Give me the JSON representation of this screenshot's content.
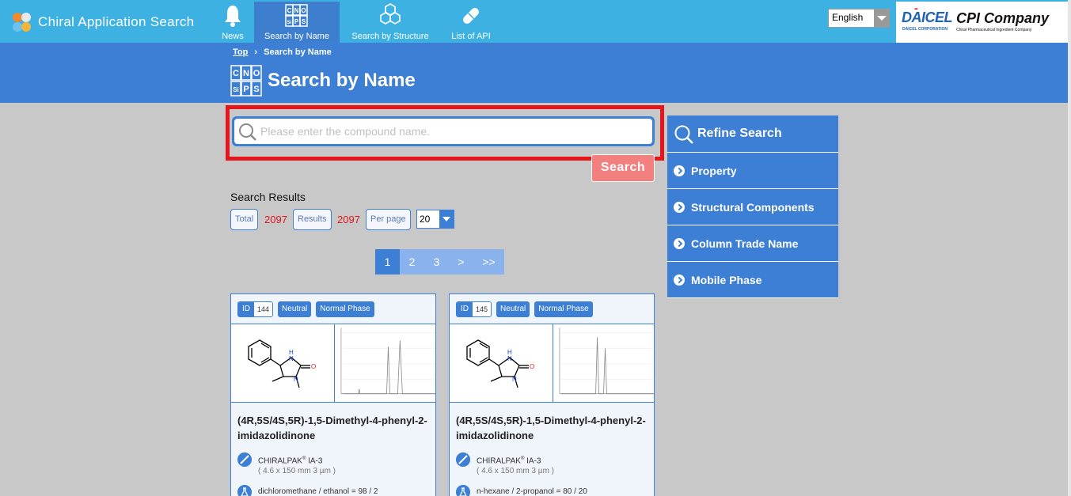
{
  "app": {
    "title": "Chiral Application Search"
  },
  "nav": [
    {
      "label": "News",
      "icon": "bell-icon"
    },
    {
      "label": "Search by Name",
      "icon": "element-grid-icon"
    },
    {
      "label": "Search by Structure",
      "icon": "molecule-icon"
    },
    {
      "label": "List of API",
      "icon": "capsule-icon"
    }
  ],
  "language": {
    "selected": "English"
  },
  "corp": {
    "daicel": "DAICEL",
    "daicel_sub": "DAICEL CORPORATION",
    "cpi": "CPI Company",
    "cpi_sub": "Chiral Pharmaceutical Ingredient Company"
  },
  "breadcrumb": {
    "top": "Top",
    "separator": "›",
    "current": "Search by Name"
  },
  "page": {
    "title": "Search by Name",
    "icon_letters": [
      "C",
      "N",
      "O",
      "Si",
      "P",
      "S"
    ]
  },
  "search": {
    "placeholder": "Please enter the compound name.",
    "value": "",
    "button": "Search"
  },
  "results": {
    "heading": "Search Results",
    "total_label": "Total",
    "total": "2097",
    "results_label": "Results",
    "results": "2097",
    "per_page_label": "Per page",
    "per_page": "20"
  },
  "pagination": [
    "1",
    "2",
    "3",
    ">",
    ">>"
  ],
  "cards": [
    {
      "id_label": "ID",
      "id": "144",
      "tags": [
        "Neutral",
        "Normal Phase"
      ],
      "name": "(4R,5S/4S,5R)-1,5-Dimethyl-4-phenyl-2-imidazolidinone",
      "column": "CHIRALPAK",
      "column_reg": "®",
      "column_model": " IA-3",
      "column_dims": "( 4.6 x 150 mm 3 µm )",
      "mobile_phase": "dichloromethane / ethanol = 98 / 2"
    },
    {
      "id_label": "ID",
      "id": "145",
      "tags": [
        "Neutral",
        "Normal Phase"
      ],
      "name": "(4R,5S/4S,5R)-1,5-Dimethyl-4-phenyl-2-imidazolidinone",
      "column": "CHIRALPAK",
      "column_reg": "®",
      "column_model": " IA-3",
      "column_dims": "( 4.6 x 150 mm 3 µm )",
      "mobile_phase": "n-hexane / 2-propanol = 80 / 20"
    }
  ],
  "refine": {
    "title": "Refine Search",
    "items": [
      "Property",
      "Structural Components",
      "Column Trade Name",
      "Mobile Phase"
    ]
  },
  "colors": {
    "nav_bg": "#3eb1e3",
    "accent": "#3d7fd5",
    "highlight": "#e4161c",
    "search_button": "#f2807f",
    "count_text": "#e4161c"
  }
}
